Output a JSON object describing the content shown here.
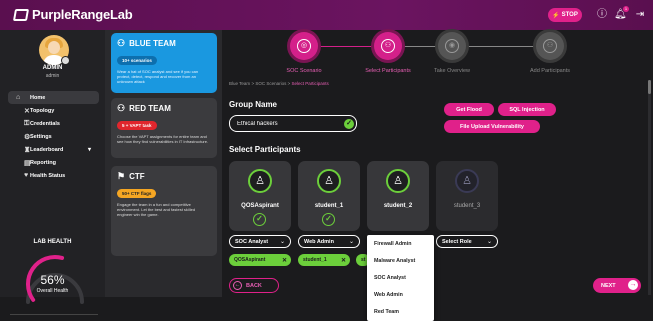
{
  "app": {
    "title": "PurpleRangeLab"
  },
  "topbar": {
    "stop_label": "STOP",
    "notif_count": "1"
  },
  "user": {
    "name": "ADMIN",
    "role": "admin"
  },
  "nav": [
    {
      "label": "Home",
      "icon": "home-icon",
      "glyph": "⌂"
    },
    {
      "label": "Topology",
      "icon": "topology-icon",
      "glyph": "✕"
    },
    {
      "label": "Credentials",
      "icon": "credentials-icon",
      "glyph": "⚿"
    },
    {
      "label": "Settings",
      "icon": "settings-icon",
      "glyph": "⚙"
    },
    {
      "label": "Leaderboard",
      "icon": "leaderboard-icon",
      "glyph": "♜"
    },
    {
      "label": "Reporting",
      "icon": "reporting-icon",
      "glyph": "▤"
    },
    {
      "label": "Health Status",
      "icon": "health-icon",
      "glyph": "♥"
    }
  ],
  "lab_health": {
    "title": "LAB HEALTH",
    "value": "56%",
    "label": "Overall Health",
    "fraction": 0.56
  },
  "cards": {
    "blue": {
      "title": "BLUE TEAM",
      "pill": "10+ scenarios",
      "desc": "Wear a hat of SOC analyst and see if you can protect, detect, respond and recover from an unknown attack"
    },
    "red": {
      "title": "RED TEAM",
      "pill": "5 + VAPT task",
      "desc": "Choose the VAPT assignments for entire team and see how they find vulnerabilities in IT Infrastructure."
    },
    "ctf": {
      "title": "CTF",
      "pill": "50+ CTF flags",
      "desc": "Engage the team in a fun and competitive environment. Let the best and fastest skilled engineer win the game."
    }
  },
  "stepper": [
    "SOC Scenario",
    "Select Participants",
    "Take Overview",
    "Add Participants"
  ],
  "breadcrumb": {
    "a": "Blue Team",
    "b": "SOC Scenarios",
    "c": "Select Participants"
  },
  "group": {
    "label": "Group Name",
    "value": "Ethical hackers"
  },
  "scenario_tags": [
    "Get Flood",
    "SQL Injection",
    "File Upload Vulnerability"
  ],
  "participants_label": "Select Participants",
  "participants": [
    {
      "name": "QOSAspirant",
      "role": "SOC Analyst"
    },
    {
      "name": "student_1",
      "role": "Web Admin"
    },
    {
      "name": "student_2",
      "role": "SOC Analyst"
    },
    {
      "name": "student_3",
      "role": "Select Role"
    }
  ],
  "chips": [
    {
      "label": "QOSAspirant",
      "close": "✕"
    },
    {
      "label": "student_1",
      "close": "✕"
    },
    {
      "label": "st",
      "close": ""
    }
  ],
  "role_options": [
    "Firewall Admin",
    "Malware Analyst",
    "SOC Analyst",
    "Web Admin",
    "Red Team"
  ],
  "buttons": {
    "back": "BACK",
    "next": "NEXT"
  },
  "colors": {
    "accent": "#e0218a",
    "success": "#6ccf3b",
    "blue_card": "#1a98e0",
    "topbar": "#6b1460"
  }
}
